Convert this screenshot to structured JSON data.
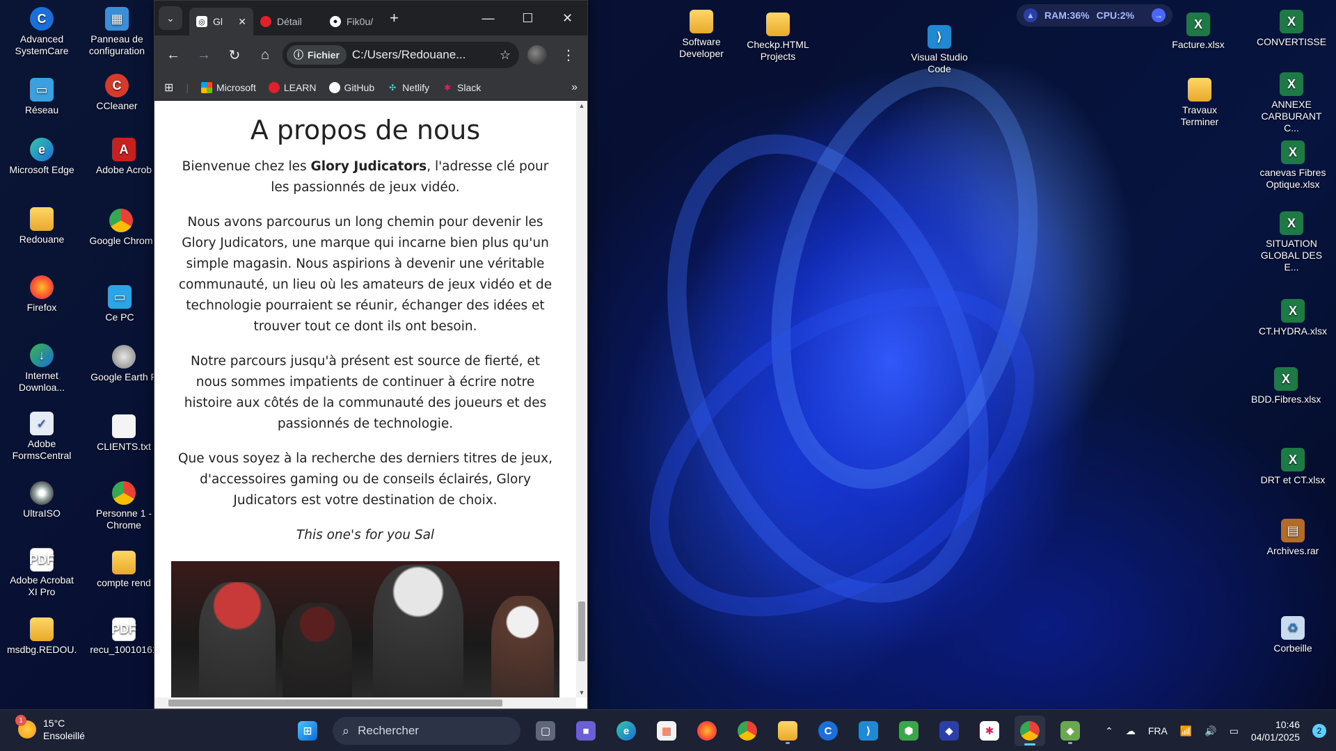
{
  "desktop": {
    "left_icons": [
      {
        "label": "Advanced SystemCare",
        "icon": "advanced-systemcare-icon"
      },
      {
        "label": "Panneau de configuration",
        "icon": "control-panel-icon"
      },
      {
        "label": "Réseau",
        "icon": "network-icon"
      },
      {
        "label": "CCleaner",
        "icon": "ccleaner-icon"
      },
      {
        "label": "Microsoft Edge",
        "icon": "edge-icon"
      },
      {
        "label": "Adobe Acrob",
        "icon": "acrobat-icon"
      },
      {
        "label": "Redouane",
        "icon": "folder-icon"
      },
      {
        "label": "Google Chrom",
        "icon": "chrome-icon"
      },
      {
        "label": "Firefox",
        "icon": "firefox-icon"
      },
      {
        "label": "Ce PC",
        "icon": "computer-icon"
      },
      {
        "label": "Internet Downloa...",
        "icon": "idm-icon"
      },
      {
        "label": "Google Earth P",
        "icon": "google-earth-icon"
      },
      {
        "label": "Adobe FormsCentral",
        "icon": "formscentral-icon"
      },
      {
        "label": "CLIENTS.txt",
        "icon": "text-file-icon"
      },
      {
        "label": "UltraISO",
        "icon": "ultraiso-icon"
      },
      {
        "label": "Personne 1 - Chrome",
        "icon": "chrome-profile-icon"
      },
      {
        "label": "Adobe Acrobat XI Pro",
        "icon": "acrobat-pdf-icon"
      },
      {
        "label": "compte rend",
        "icon": "folder-icon"
      },
      {
        "label": "msdbg.REDOU...",
        "icon": "folder-icon"
      },
      {
        "label": "recu_10010161",
        "icon": "pdf-file-icon"
      }
    ],
    "mid_icons": [
      {
        "label": "Software Developer",
        "icon": "folder-icon"
      },
      {
        "label": "Checkp.HTML Projects",
        "icon": "folder-icon"
      },
      {
        "label": "Visual Studio Code",
        "icon": "vscode-icon"
      }
    ],
    "right_icons": [
      {
        "label": "Facture.xlsx",
        "icon": "excel-icon"
      },
      {
        "label": "CONVERTISSEU...",
        "icon": "excel-icon"
      },
      {
        "label": "Travaux Terminer",
        "icon": "folder-icon"
      },
      {
        "label": "ANNEXE CARBURANT C...",
        "icon": "excel-icon"
      },
      {
        "label": "canevas Fibres Optique.xlsx",
        "icon": "excel-icon"
      },
      {
        "label": "SITUATION GLOBAL DES E...",
        "icon": "excel-icon"
      },
      {
        "label": "CT.HYDRA.xlsx",
        "icon": "excel-icon"
      },
      {
        "label": "BDD.Fibres.xlsx",
        "icon": "excel-icon"
      },
      {
        "label": "DRT et CT.xlsx",
        "icon": "excel-icon"
      },
      {
        "label": "Archives.rar",
        "icon": "archive-icon"
      },
      {
        "label": "Corbeille",
        "icon": "recycle-bin-icon"
      }
    ]
  },
  "perf_widget": {
    "ram": "RAM:36%",
    "cpu": "CPU:2%"
  },
  "browser": {
    "tabs": [
      {
        "label": "Gl",
        "icon": "gamepad-icon",
        "active": true
      },
      {
        "label": "Détail",
        "icon": "opera-icon",
        "active": false
      },
      {
        "label": "Fik0u/",
        "icon": "github-icon",
        "active": false
      }
    ],
    "new_tab": "+",
    "address_chip": "Fichier",
    "url": "C:/Users/Redouane...",
    "bookmarks": [
      {
        "label": "Microsoft",
        "icon": "microsoft-icon"
      },
      {
        "label": "LEARN",
        "icon": "opera-icon"
      },
      {
        "label": "GitHub",
        "icon": "github-icon"
      },
      {
        "label": "Netlify",
        "icon": "netlify-icon"
      },
      {
        "label": "Slack",
        "icon": "slack-icon"
      }
    ],
    "page": {
      "heading": "A propos de nous",
      "p1_pre": "Bienvenue chez les ",
      "p1_bold": "Glory Judicators",
      "p1_post": ", l'adresse clé pour les passionnés de jeux vidéo.",
      "p2": "Nous avons parcourus un long chemin pour devenir les Glory Judicators, une marque qui incarne bien plus qu'un simple magasin. Nous aspirions à devenir une véritable communauté, un lieu où les amateurs de jeux vidéo et de technologie pourraient se réunir, échanger des idées et trouver tout ce dont ils ont besoin.",
      "p3": "Notre parcours jusqu'à présent est source de fierté, et nous sommes impatients de continuer à écrire notre histoire aux côtés de la communauté des joueurs et des passionnés de technologie.",
      "p4": "Que vous soyez à la recherche des derniers titres de jeux, d'accessoires gaming ou de conseils éclairés, Glory Judicators est votre destination de choix.",
      "tagline": "This one's for you Sal"
    }
  },
  "taskbar": {
    "weather_temp": "15°C",
    "weather_desc": "Ensoleillé",
    "weather_badge": "1",
    "search_placeholder": "Rechercher",
    "lang": "FRA",
    "time": "10:46",
    "date": "04/01/2025",
    "notifications": "2"
  }
}
